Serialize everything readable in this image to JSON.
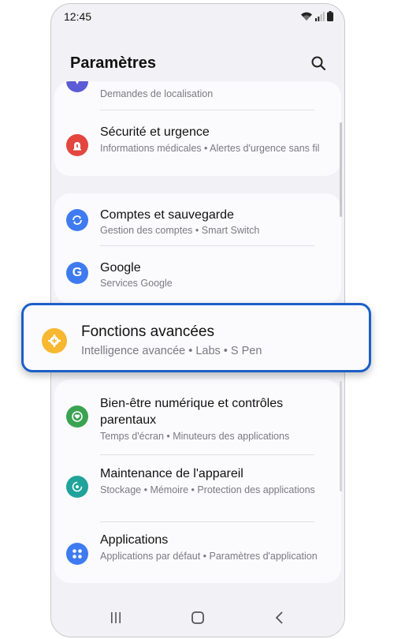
{
  "status_bar": {
    "time": "12:45",
    "icons": [
      "wifi-icon",
      "signal-icon",
      "battery-icon"
    ]
  },
  "header": {
    "title": "Paramètres",
    "search_icon": "search-icon"
  },
  "items": {
    "location": {
      "subtitle": "Demandes de localisation",
      "icon": "location-icon",
      "color": "#5b5bd6"
    },
    "security": {
      "title": "Sécurité et urgence",
      "subtitle": "Informations médicales • Alertes d'urgence sans fil",
      "icon": "emergency-icon",
      "color": "#e3463f"
    },
    "accounts": {
      "title": "Comptes et sauvegarde",
      "subtitle": "Gestion des comptes • Smart Switch",
      "icon": "sync-icon",
      "color": "#3e7bf0"
    },
    "google": {
      "title": "Google",
      "subtitle": "Services Google",
      "icon": "google-icon",
      "color": "#3e7bf0"
    },
    "advanced": {
      "title": "Fonctions avancées",
      "subtitle": "Intelligence avancée  •  Labs  •  S Pen",
      "icon": "gear-plus-icon",
      "color": "#f7b731"
    },
    "wellbeing": {
      "title": "Bien-être numérique et contrôles parentaux",
      "subtitle": "Temps d'écran • Minuteurs des applications",
      "icon": "heart-circle-icon",
      "color": "#3aa352"
    },
    "maintenance": {
      "title": "Maintenance de l'appareil",
      "subtitle": "Stockage • Mémoire • Protection des applications",
      "icon": "maintenance-icon",
      "color": "#1fa39a"
    },
    "applications": {
      "title": "Applications",
      "subtitle": "Applications par défaut • Paramètres d'application",
      "icon": "apps-icon",
      "color": "#3e7bf0"
    }
  },
  "nav_bar": {
    "recents": "recents-icon",
    "home": "home-icon",
    "back": "back-icon"
  },
  "colors": {
    "highlight_border": "#1c5fc8",
    "background": "#f2f2f6",
    "card": "#fbfbfd"
  }
}
